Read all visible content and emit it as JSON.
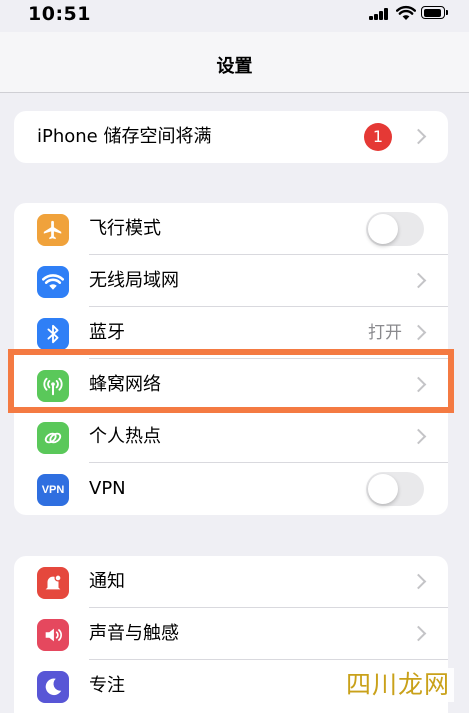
{
  "status_bar": {
    "time": "10:51",
    "battery_level": 0.9
  },
  "nav": {
    "title": "设置"
  },
  "storage": {
    "label": "iPhone 储存空间将满",
    "badge": "1"
  },
  "connectivity": {
    "airplane": {
      "label": "飞行模式",
      "icon": "airplane-icon",
      "color": "#f0a23b",
      "on": false
    },
    "wifi": {
      "label": "无线局域网",
      "icon": "wifi-icon",
      "color": "#2f7ff6"
    },
    "bluetooth": {
      "label": "蓝牙",
      "value": "打开",
      "icon": "bluetooth-icon",
      "color": "#2f7ff6"
    },
    "cellular": {
      "label": "蜂窝网络",
      "icon": "cellular-antenna-icon",
      "color": "#5ac85a"
    },
    "hotspot": {
      "label": "个人热点",
      "icon": "hotspot-link-icon",
      "color": "#5ac85a"
    },
    "vpn": {
      "label": "VPN",
      "icon_text": "VPN",
      "color": "#2f6fe0",
      "on": false
    }
  },
  "system": {
    "notifications": {
      "label": "通知",
      "icon": "notification-bell-icon",
      "color": "#e5483d"
    },
    "sounds": {
      "label": "声音与触感",
      "icon": "speaker-icon",
      "color": "#e5485e"
    },
    "focus": {
      "label": "专注",
      "icon": "moon-icon",
      "color": "#5856d6"
    }
  },
  "watermark": "四川龙网",
  "highlight_color": "#f47a42"
}
